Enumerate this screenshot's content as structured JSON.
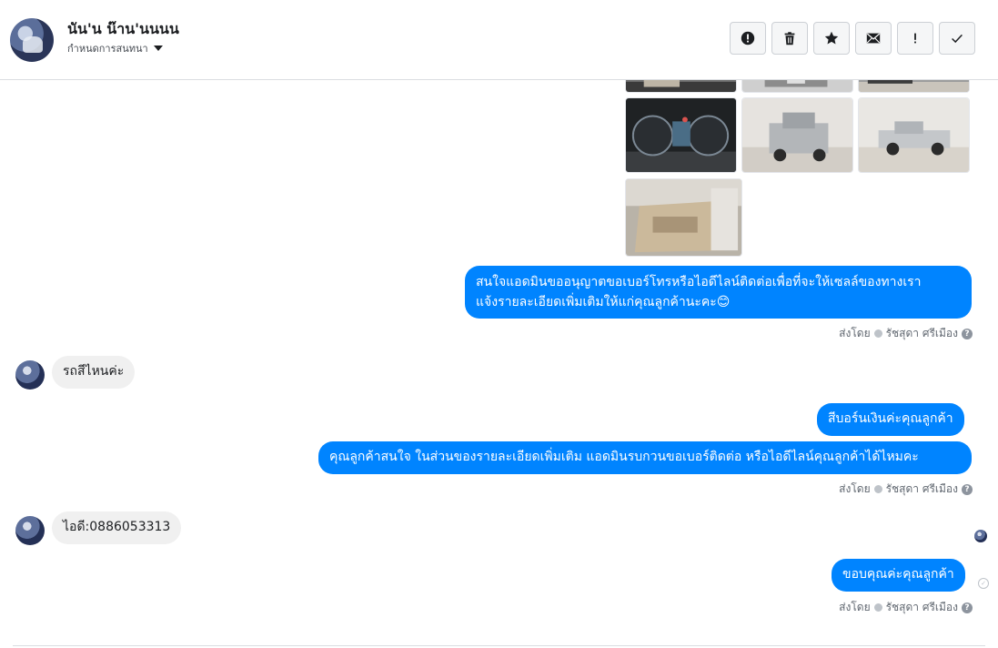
{
  "header": {
    "contact_name": "นัน'น น๊าน'นนนน",
    "subtitle": "กำหนดการสนทนา",
    "actions": [
      {
        "name": "report-button",
        "icon": "exclamation-circle-icon"
      },
      {
        "name": "delete-button",
        "icon": "trash-icon"
      },
      {
        "name": "star-button",
        "icon": "star-icon"
      },
      {
        "name": "mark-unread-button",
        "icon": "envelope-icon"
      },
      {
        "name": "important-button",
        "icon": "exclamation-icon"
      },
      {
        "name": "mark-done-button",
        "icon": "check-icon"
      }
    ]
  },
  "messages": {
    "out1": "สนใจแอดมินขออนุญาตขอเบอร์โทรหรือไอดีไลน์ติดต่อเพื่อที่จะให้เซลล์ของทางเรา",
    "out1_line2": "แจ้งรายละเอียดเพิ่มเติมให้แก่คุณลูกค้านะคะ😊",
    "in1": "รถสีไหนค่ะ",
    "out2": "สีบอร์นเงินค่ะคุณลูกค้า",
    "out3": "คุณลูกค้าสนใจ ในส่วนของรายละเอียดเพิ่มเติม แอดมินรบกวนขอเบอร์ติดต่อ หรือไอดีไลน์คุณลูกค้าได้ไหมคะ",
    "in2": "ไอดี:0886053313",
    "out4": "ขอบคุณค่ะคุณลูกค้า"
  },
  "sent_by": {
    "label": "ส่งโดย",
    "agent": "รัชสุดา ศรีเมือง"
  },
  "colors": {
    "outgoing_bubble": "#0084ff",
    "incoming_bubble": "#f0f0f0"
  }
}
